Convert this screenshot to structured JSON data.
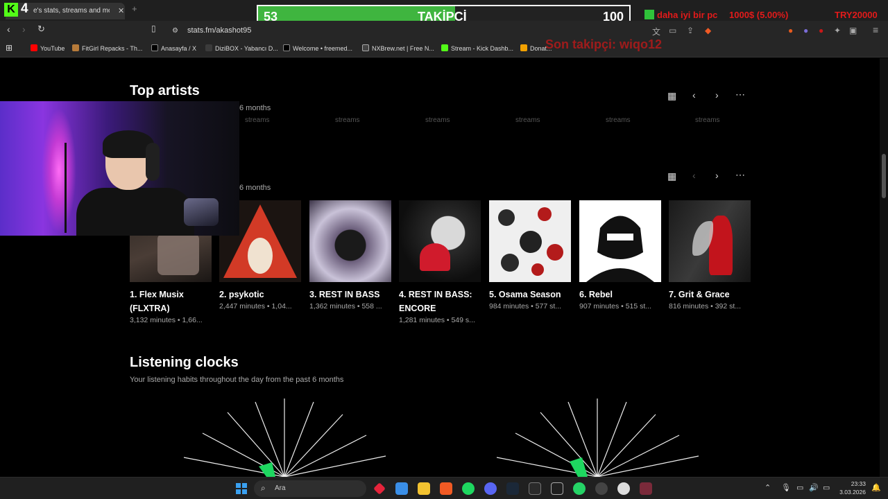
{
  "overlay": {
    "kick_number": "4",
    "follower_current": "53",
    "follower_label": "TAKİPÇİ",
    "follower_goal": "100",
    "follower_progress": 0.53,
    "ticker_a": "daha iyi bir pc",
    "ticker_b": "1000$ (5.00%)",
    "ticker_c": "TRY20000",
    "last_follower": "Son takipçi: wiqo12"
  },
  "browser": {
    "tab_title": "e's stats, streams and more",
    "url": "stats.fm/akashot95",
    "bookmarks": [
      "YouTube",
      "FitGirl Repacks - Th...",
      "Anasayfa / X",
      "DiziBOX - Yabancı D...",
      "Welcome • freemed...",
      "NXBrew.net | Free N...",
      "Stream - Kick Dashb...",
      "Donat..."
    ]
  },
  "page": {
    "top_artists": {
      "title": "Top artists",
      "period": "6 months",
      "ghost_label": "streams"
    },
    "top_albums": {
      "period": "6 months",
      "cards": [
        {
          "rank_title": "1. Flex Musix (FLXTRA)",
          "meta": "3,132 minutes • 1,66..."
        },
        {
          "rank_title": "2. psykotic",
          "meta": "2,447 minutes • 1,04..."
        },
        {
          "rank_title": "3. REST IN BASS",
          "meta": "1,362 minutes • 558 ..."
        },
        {
          "rank_title": "4. REST IN BASS: ENCORE",
          "meta": "1,281 minutes • 549 s..."
        },
        {
          "rank_title": "5. Osama Season",
          "meta": "984 minutes • 577 st..."
        },
        {
          "rank_title": "6. Rebel",
          "meta": "907 minutes • 515 st..."
        },
        {
          "rank_title": "7. Grit & Grace",
          "meta": "816 minutes • 392 st..."
        }
      ]
    },
    "listening_clocks": {
      "title": "Listening clocks",
      "subtitle": "Your listening habits throughout the day from the past 6 months"
    }
  },
  "taskbar": {
    "search_placeholder": "Ara",
    "time": "23:33",
    "date": "3.03.2026"
  },
  "colors": {
    "accent": "#1ed760",
    "follow_fill": "#3fb53f",
    "ticker": "#e31a1a"
  }
}
